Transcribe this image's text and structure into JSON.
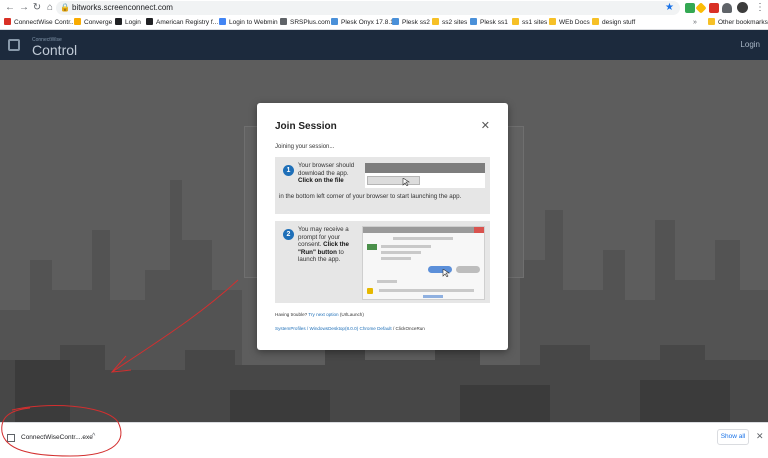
{
  "browser": {
    "url": "bitworks.screenconnect.com",
    "bookmarks": [
      {
        "label": "ConnectWise Contr...",
        "color": "#d93025"
      },
      {
        "label": "Converge",
        "color": "#f9ab00"
      },
      {
        "label": "Login",
        "color": "#202124"
      },
      {
        "label": "American Registry f...",
        "color": "#202124"
      },
      {
        "label": "Login to Webmin",
        "color": "#4285f4"
      },
      {
        "label": "SRSPlus.com",
        "color": "#5f6368"
      },
      {
        "label": "Plesk Onyx 17.8.11",
        "color": "#4a90d9"
      },
      {
        "label": "Plesk ss2",
        "color": "#4a90d9"
      },
      {
        "label": "ss2 sites",
        "color": "#f6c026"
      },
      {
        "label": "Plesk ss1",
        "color": "#4a90d9"
      },
      {
        "label": "ss1 sites",
        "color": "#f6c026"
      },
      {
        "label": "WEb Docs",
        "color": "#f6c026"
      },
      {
        "label": "design stuff",
        "color": "#f6c026"
      }
    ],
    "more_chevron": "»",
    "other_bookmarks": "Other bookmarks"
  },
  "header": {
    "brand_small": "ConnectWise",
    "brand": "Control",
    "login": "Login"
  },
  "modal": {
    "title": "Join Session",
    "close": "✕",
    "status": "Joining your session...",
    "step1": {
      "number": "1",
      "text_a": "Your browser should download the app.",
      "text_b": "Click on the file",
      "text_c": "in the bottom left corner of your browser to start launching the app."
    },
    "step2": {
      "number": "2",
      "text_a": "You may receive a prompt for your consent.",
      "text_b": "Click the \"Run\" button",
      "text_c": "to launch the app."
    },
    "trouble_prefix": "Having trouble?",
    "trouble_link": "Try next option",
    "trouble_suffix": "(UrlLaunch)",
    "path_links": "SystemProfiles / WindowsDesktop(8.0.0) Chrome Default",
    "path_suffix": "/ ClickOnceRun"
  },
  "download_shelf": {
    "file_name": "ConnectWiseContr....exe",
    "caret": "^",
    "show_all": "Show all",
    "close": "✕"
  },
  "colors": {
    "header_bg": "#1c2a3d",
    "page_bg": "#5d5d5d",
    "accent": "#1e6fb8",
    "annotation": "#d32f2f"
  }
}
